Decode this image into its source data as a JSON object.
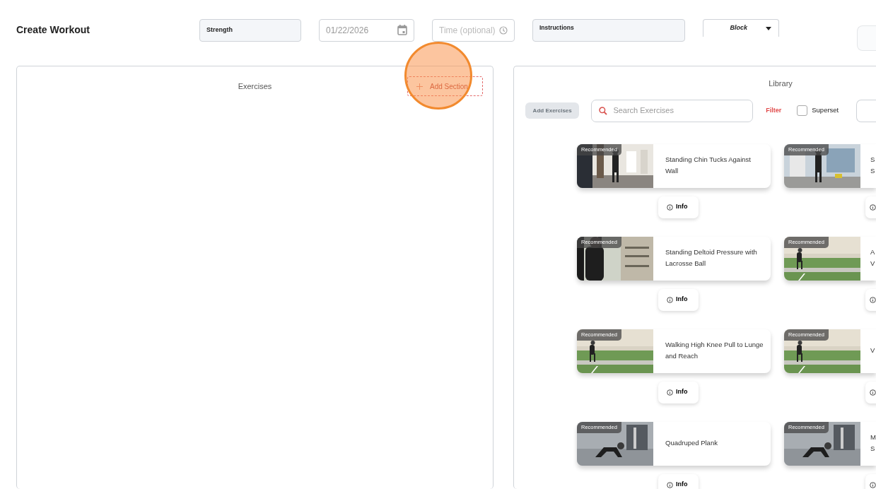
{
  "header": {
    "title": "Create Workout",
    "type_field": {
      "value": "Strength"
    },
    "date_field": {
      "value": "01/22/2026"
    },
    "time_field": {
      "placeholder": "Time (optional)"
    },
    "instructions_field": {
      "label": "Instructions"
    },
    "block_select": {
      "value": "Block"
    }
  },
  "exercises_panel": {
    "title": "Exercises",
    "add_section_button": "Add Section"
  },
  "library_panel": {
    "title": "Library",
    "add_exercises_button": "Add Exercises",
    "search": {
      "placeholder": "Search Exercises"
    },
    "filter_link": "Filter",
    "superset": {
      "label": "Superset",
      "checked": false
    },
    "cards": [
      {
        "badge": "Recommended",
        "title": "Standing Chin Tucks Against Wall",
        "info": "Info"
      },
      {
        "badge": "Recommended",
        "title": "S\nS"
      },
      {
        "badge": "Recommended",
        "title": "Standing Deltoid Pressure with Lacrosse Ball",
        "info": "Info"
      },
      {
        "badge": "Recommended",
        "title": "A\nV"
      },
      {
        "badge": "Recommended",
        "title": "Walking High Knee Pull to Lunge and Reach",
        "info": "Info"
      },
      {
        "badge": "Recommended",
        "title": "V"
      },
      {
        "badge": "Recommended",
        "title": "Quadruped Plank",
        "info": "Info"
      },
      {
        "badge": "Recommended",
        "title": "M\nS"
      }
    ]
  }
}
